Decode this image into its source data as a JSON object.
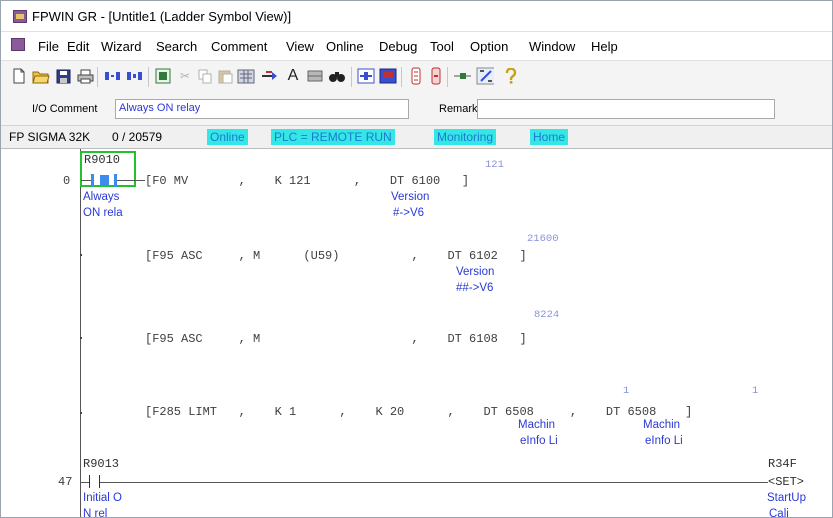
{
  "window": {
    "title": "FPWIN GR - [Untitle1 (Ladder Symbol View)]"
  },
  "menu": {
    "items": [
      "File",
      "Edit",
      "Wizard",
      "Search",
      "Comment",
      "View",
      "Online",
      "Debug",
      "Tool",
      "Option",
      "Window",
      "Help"
    ]
  },
  "comment_bar": {
    "io_label": "I/O Comment",
    "io_value": "Always ON relay",
    "remark_label": "Remark",
    "remark_value": ""
  },
  "status": {
    "plc_model": "FP SIGMA 32K",
    "steps": "0 / 20579",
    "online": "Online",
    "plc_mode": "PLC = REMOTE RUN",
    "monitoring": "Monitoring",
    "home": "Home"
  },
  "ladder": {
    "rung1": {
      "address": "0",
      "contact": "R9010",
      "contact_comment_1": "Always",
      "contact_comment_2": "ON rela",
      "instructions": [
        {
          "text": "[F0 MV       ,    K 121      ,    DT 6100   ]",
          "monitor": "121",
          "comment_1": "Version",
          "comment_2": "#->V6"
        },
        {
          "text": "[F95 ASC     , M      (U59)          ,    DT 6102   ]",
          "monitor": "21600",
          "comment_1": "Version",
          "comment_2": "##->V6"
        },
        {
          "text": "[F95 ASC     , M                     ,    DT 6108   ]",
          "monitor": "8224"
        },
        {
          "text": "[F285 LIMT   ,    K 1      ,    K 20      ,    DT 6508     ,    DT 6508    ]",
          "monitor_1": "1",
          "monitor_2": "1",
          "comment_a_1": "Machin",
          "comment_a_2": "eInfo Li",
          "comment_b_1": "Machin",
          "comment_b_2": "eInfo Li"
        }
      ]
    },
    "rung2": {
      "address": "47",
      "contact": "R9013",
      "contact_comment_1": "Initial O",
      "contact_comment_2": "N rel",
      "coil": "R34F",
      "coil_type": "<SET>",
      "coil_comment_1": "StartUp",
      "coil_comment_2": "Cali"
    }
  },
  "toolbar": {
    "icons": [
      "new-file-icon",
      "open-folder-icon",
      "save-icon",
      "print-icon",
      "online-edit-icon",
      "offline-edit-icon",
      "comment-icon",
      "cut-icon",
      "copy-icon",
      "paste-icon",
      "convert-icon",
      "insert-icon",
      "text-icon",
      "block-icon",
      "find-icon",
      "monitor-icon",
      "monitor-window-icon",
      "plc-up-icon",
      "plc-down-icon",
      "run-icon",
      "toggle-icon",
      "help-icon"
    ]
  },
  "colors": {
    "status_highlight": "#35e6e6",
    "status_text": "#1b7bd0",
    "comment_text": "#2a39d6",
    "monitor_value": "#8c93dc",
    "contact_on": "#3c8cf0",
    "contact_select": "#22c22e"
  }
}
